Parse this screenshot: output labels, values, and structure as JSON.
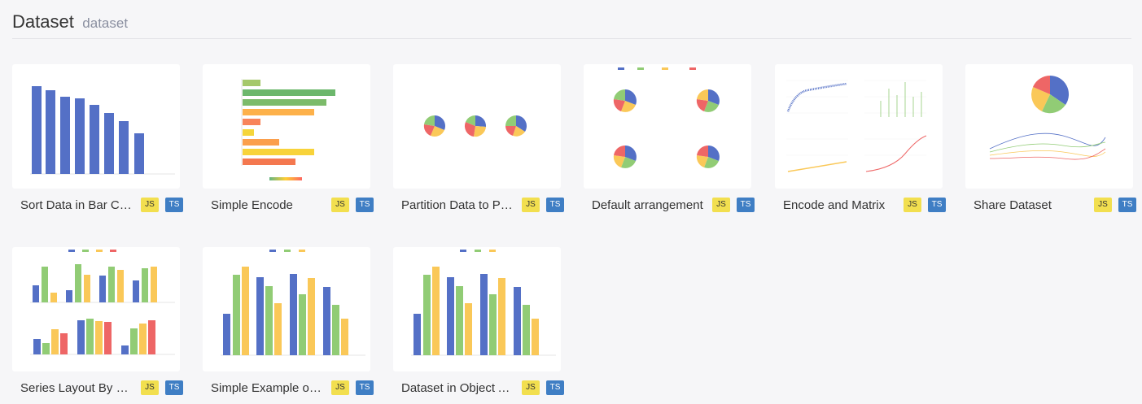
{
  "header": {
    "title": "Dataset",
    "subtitle": "dataset"
  },
  "badges": {
    "js": "JS",
    "ts": "TS"
  },
  "colors": {
    "blue": "#5470c6",
    "green": "#91cc75",
    "yellow": "#fac858",
    "red": "#ee6666"
  },
  "cards": [
    {
      "title": "Sort Data in Bar Chart"
    },
    {
      "title": "Simple Encode"
    },
    {
      "title": "Partition Data to Pies"
    },
    {
      "title": "Default arrangement"
    },
    {
      "title": "Encode and Matrix"
    },
    {
      "title": "Share Dataset"
    },
    {
      "title": "Series Layout By Column or Row"
    },
    {
      "title": "Simple Example of Dataset"
    },
    {
      "title": "Dataset in Object Array"
    }
  ]
}
